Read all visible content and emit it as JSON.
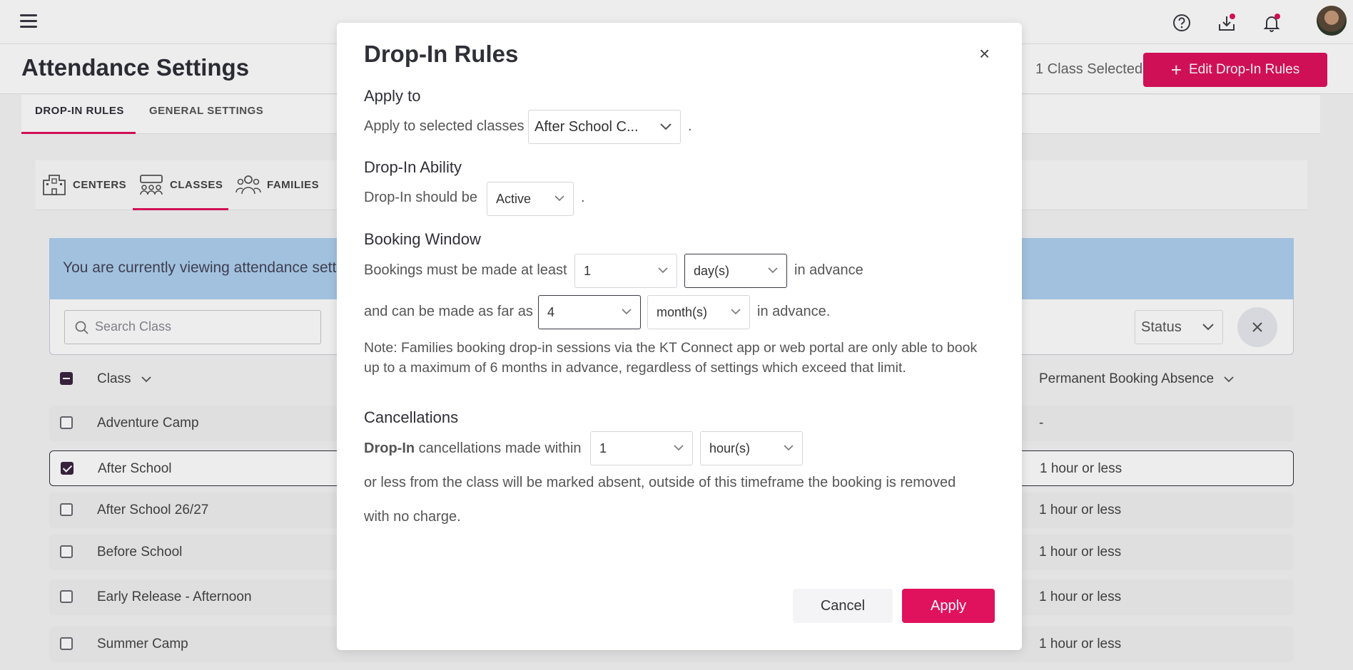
{
  "app": {
    "page_title": "Attendance Settings",
    "selected_count": "1 Class Selected",
    "edit_button": "Edit Drop-In Rules",
    "icons": [
      "menu-icon",
      "help-icon",
      "download-icon",
      "bell-icon"
    ],
    "accent_color": "#e0125d"
  },
  "tabs": [
    {
      "label": "DROP-IN RULES",
      "active": true
    },
    {
      "label": "GENERAL SETTINGS",
      "active": false
    }
  ],
  "subtabs": [
    {
      "label": "CENTERS",
      "icon": "building-icon",
      "active": false
    },
    {
      "label": "CLASSES",
      "icon": "classroom-icon",
      "active": true
    },
    {
      "label": "FAMILIES",
      "icon": "people-icon",
      "active": false
    }
  ],
  "banner": {
    "text": "You are currently viewing attendance settin"
  },
  "filters": {
    "search_placeholder": "Search Class",
    "status_label": "Status"
  },
  "table": {
    "columns": [
      "Class",
      "Permanent Booking Absence"
    ],
    "rows": [
      {
        "name": "Adventure Camp",
        "absence": "-",
        "checked": false
      },
      {
        "name": "After School",
        "absence": "1 hour or less",
        "checked": true
      },
      {
        "name": "After School 26/27",
        "absence": "1 hour or less",
        "checked": false
      },
      {
        "name": "Before School",
        "absence": "1 hour or less",
        "checked": false
      },
      {
        "name": "Early Release - Afternoon",
        "absence": "1 hour or less",
        "checked": false
      },
      {
        "name": "Summer Camp",
        "absence": "1 hour or less",
        "checked": false
      }
    ]
  },
  "modal": {
    "title": "Drop-In Rules",
    "close": "×",
    "apply_to": {
      "title": "Apply to",
      "label": "Apply to selected classes",
      "value": "After School C...",
      "suffix": "."
    },
    "ability": {
      "title": "Drop-In Ability",
      "label": "Drop-In should be",
      "value": "Active",
      "suffix": "."
    },
    "booking_window": {
      "title": "Booking Window",
      "min_label": "Bookings must be made at least",
      "min_value": "1",
      "min_unit": "day(s)",
      "min_suffix": "in advance",
      "max_label": "and can be made as far as",
      "max_value": "4",
      "max_unit": "month(s)",
      "max_suffix": "in advance.",
      "note": "Note: Families booking drop-in sessions via the KT Connect app or web portal are only able to book up to a maximum of 6 months in advance, regardless of settings which exceed that limit."
    },
    "cancellations": {
      "title": "Cancellations",
      "label_bold": "Drop-In",
      "label": "cancellations made within",
      "value": "1",
      "unit": "hour(s)",
      "line2": "or less from the class will be marked absent, outside of this timeframe the booking is removed",
      "line3": "with no charge."
    },
    "cancel_button": "Cancel",
    "apply_button": "Apply"
  }
}
